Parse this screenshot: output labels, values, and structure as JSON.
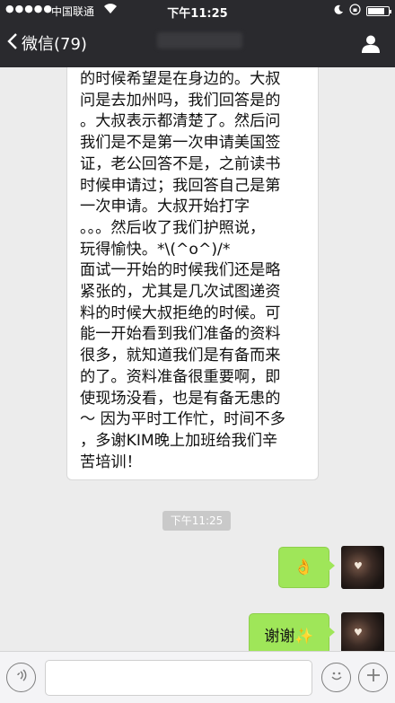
{
  "status_bar": {
    "signal": "●●●●●",
    "carrier": "中国联通",
    "wifi_icon": "wifi-icon",
    "time": "下午11:25"
  },
  "nav": {
    "back_label": "微信(79)",
    "contact_name": "",
    "profile_icon": "person-icon"
  },
  "messages": {
    "incoming_text": "的时候希望是在身边的。大叔\n问是去加州吗，我们回答是的\n。大叔表示都清楚了。然后问\n我们是不是第一次申请美国签\n证，老公回答不是，之前读书\n时候申请过；我回答自己是第\n一次申请。大叔开始打字\n。。。然后收了我们护照说，\n玩得愉快。*\\(^o^)/*\n面试一开始的时候我们还是略\n紧张的，尤其是几次试图递资\n料的时候大叔拒绝的时候。可\n能一开始看到我们准备的资料\n很多，就知道我们是有备而来\n的了。资料准备很重要啊，即\n使现场没看，也是有备无患的\n～ 因为平时工作忙，时间不多\n，多谢KIM晚上加班给我们辛\n苦培训！",
    "timestamp": "下午11:25",
    "outgoing_1": "👌",
    "outgoing_2": "谢谢✨"
  },
  "colors": {
    "top_bar": "#2a2a2e",
    "chat_bg": "#ececec",
    "outgoing_bubble": "#9fe659"
  }
}
